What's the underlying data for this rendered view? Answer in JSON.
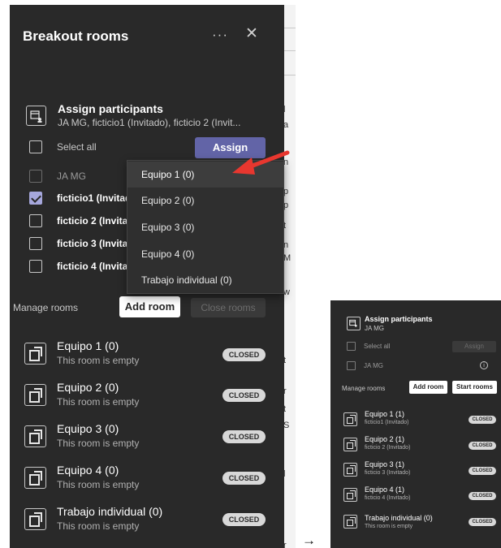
{
  "panel": {
    "title": "Breakout rooms",
    "more_glyph": "···",
    "close_glyph": "✕",
    "assign": {
      "title": "Assign participants",
      "subtitle": "JA MG, ficticio1 (Invitado), ficticio 2 (Invit..."
    },
    "select_all": "Select all",
    "assign_button": "Assign",
    "participants": [
      {
        "name": "JA MG",
        "checked": false,
        "dim": true
      },
      {
        "name": "ficticio1 (Invitado)",
        "checked": true,
        "dim": false
      },
      {
        "name": "ficticio 2 (Invitado)",
        "checked": false,
        "dim": false
      },
      {
        "name": "ficticio 3 (Invitado)",
        "checked": false,
        "dim": false
      },
      {
        "name": "ficticio 4 (Invitado)",
        "checked": false,
        "dim": false
      }
    ],
    "manage_label": "Manage rooms",
    "add_room_button": "Add room",
    "close_rooms_button": "Close rooms",
    "rooms": [
      {
        "name": "Equipo 1 (0)",
        "status": "This room is empty",
        "badge": "CLOSED"
      },
      {
        "name": "Equipo 2 (0)",
        "status": "This room is empty",
        "badge": "CLOSED"
      },
      {
        "name": "Equipo 3 (0)",
        "status": "This room is empty",
        "badge": "CLOSED"
      },
      {
        "name": "Equipo 4 (0)",
        "status": "This room is empty",
        "badge": "CLOSED"
      },
      {
        "name": "Trabajo individual (0)",
        "status": "This room is empty",
        "badge": "CLOSED"
      }
    ],
    "menu": [
      "Equipo 1 (0)",
      "Equipo 2 (0)",
      "Equipo 3 (0)",
      "Equipo 4 (0)",
      "Trabajo individual (0)"
    ]
  },
  "background_fragments": [
    "l",
    "a",
    "n",
    "p",
    "p",
    "t",
    "n",
    "M",
    "w",
    "t",
    "r",
    "t",
    "S",
    "l",
    "r"
  ],
  "flow_arrow": "→",
  "panel2": {
    "assign": {
      "title": "Assign participants",
      "subtitle": "JA MG"
    },
    "select_all": "Select all",
    "assign_button": "Assign",
    "participant": "JA MG",
    "info_glyph": "i",
    "manage_label": "Manage rooms",
    "add_room_button": "Add room",
    "start_rooms_button": "Start rooms",
    "rooms": [
      {
        "name": "Equipo 1 (1)",
        "status": "ficticio1 (Invitado)",
        "badge": "CLOSED"
      },
      {
        "name": "Equipo 2 (1)",
        "status": "ficticio 2 (Invitado)",
        "badge": "CLOSED"
      },
      {
        "name": "Equipo 3 (1)",
        "status": "ficticio 3 (Invitado)",
        "badge": "CLOSED"
      },
      {
        "name": "Equipo 4 (1)",
        "status": "ficticio 4 (Invitado)",
        "badge": "CLOSED"
      },
      {
        "name": "Trabajo individual (0)",
        "status": "This room is empty",
        "badge": "CLOSED"
      }
    ]
  },
  "colors": {
    "panel_bg": "#292929",
    "accent": "#6264a7",
    "check": "#a6a7dc",
    "arrow": "#e8372f"
  }
}
